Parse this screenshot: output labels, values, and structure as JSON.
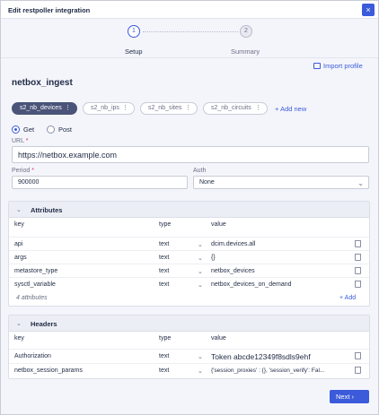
{
  "dialog": {
    "title": "Edit restpoller integration",
    "close_icon": "×"
  },
  "stepper": {
    "steps": [
      {
        "number": "1",
        "label": "Setup"
      },
      {
        "number": "2",
        "label": "Summary"
      }
    ]
  },
  "import_label": "Import profile",
  "integration_name": "netbox_ingest",
  "tabs": [
    {
      "label": "s2_nb_devices",
      "menu": "⋮"
    },
    {
      "label": "s2_nb_ips",
      "menu": "⋮"
    },
    {
      "label": "s2_nb_sites",
      "menu": "⋮"
    },
    {
      "label": "s2_nb_circuits",
      "menu": "⋮"
    }
  ],
  "add_new": {
    "icon": "+",
    "label": "Add new"
  },
  "method": {
    "options": [
      "Get",
      "Post"
    ],
    "selected": "Get"
  },
  "url": {
    "label": "URL",
    "required": "*",
    "value": "https://netbox.example.com"
  },
  "period": {
    "label": "Period",
    "required": "*",
    "value": "900000"
  },
  "auth": {
    "label": "Auth",
    "value": "None"
  },
  "attributes": {
    "title": "Attributes",
    "columns": [
      "key",
      "type",
      "value"
    ],
    "rows": [
      {
        "key": "api",
        "type": "text",
        "value": "dcim.devices.all"
      },
      {
        "key": "args",
        "type": "text",
        "value": "{}"
      },
      {
        "key": "metastore_type",
        "type": "text",
        "value": "netbox_devices"
      },
      {
        "key": "sysctl_variable",
        "type": "text",
        "value": "netbox_devices_on_demand"
      }
    ],
    "count_label": "4 attributes",
    "add_label": "Add"
  },
  "headers": {
    "title": "Headers",
    "columns": [
      "key",
      "type",
      "value"
    ],
    "rows": [
      {
        "key": "Authorization",
        "type": "text",
        "value": "Token abcde12349f8sdls9ehf"
      },
      {
        "key": "netbox_session_params",
        "type": "text",
        "value": "{'session_proxies' : {}, 'session_verify': Fal..."
      }
    ]
  },
  "next_label": "Next",
  "colors": {
    "accent": "#3b5bdb",
    "active_tab": "#4a5478"
  }
}
